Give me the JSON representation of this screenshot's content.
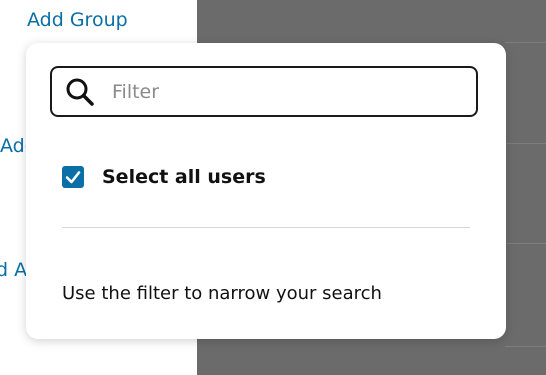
{
  "background": {
    "links": [
      "Add Group",
      "Add",
      "d A"
    ]
  },
  "popover": {
    "filter": {
      "placeholder": "Filter",
      "value": ""
    },
    "select_all": {
      "label": "Select all users",
      "checked": true
    },
    "hint": "Use the filter to narrow your search"
  },
  "colors": {
    "accent": "#0a6fa6",
    "overlay": "#6b6b6b"
  }
}
